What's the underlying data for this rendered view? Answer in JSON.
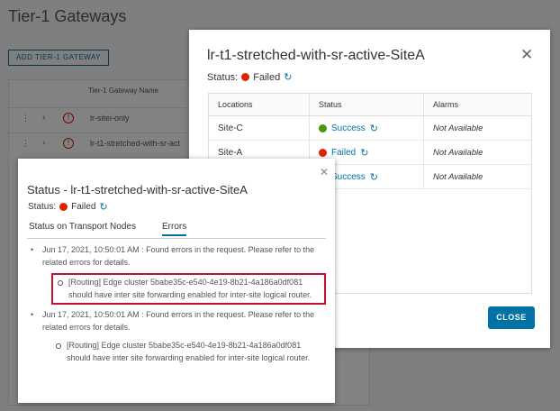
{
  "background": {
    "title": "Tier-1 Gateways",
    "add_button": "ADD TIER-1 GATEWAY",
    "column_header": "Tier-1 Gateway Name",
    "rows": [
      {
        "name": "lr-sitei-only"
      },
      {
        "name": "lr-t1-stretched-with-sr-act"
      }
    ]
  },
  "modal": {
    "title": "lr-t1-stretched-with-sr-active-SiteA",
    "status_label": "Status:",
    "status_value": "Failed",
    "table": {
      "headers": [
        "Locations",
        "Status",
        "Alarms"
      ],
      "rows": [
        {
          "location": "Site-C",
          "status": "Success",
          "alarms": "Not Available"
        },
        {
          "location": "Site-A",
          "status": "Failed",
          "alarms": "Not Available"
        },
        {
          "location": "",
          "status": "Success",
          "alarms": "Not Available"
        }
      ]
    },
    "close_button": "CLOSE"
  },
  "popover": {
    "title": "Status - lr-t1-stretched-with-sr-active-SiteA",
    "status_label": "Status:",
    "status_value": "Failed",
    "tabs": [
      "Status on Transport Nodes",
      "Errors"
    ],
    "active_tab": "Errors",
    "errors": [
      {
        "text": "Jun 17, 2021, 10:50:01 AM : Found errors in the request. Please refer to the related errors for details.",
        "detail": "[Routing] Edge cluster 5babe35c-e540-4e19-8b21-4a186a0df081 should have inter site forwarding enabled for inter-site logical router."
      },
      {
        "text": "Jun 17, 2021, 10:50:01 AM : Found errors in the request. Please refer to the related errors for details.",
        "detail": "[Routing] Edge cluster 5babe35c-e540-4e19-8b21-4a186a0df081 should have inter site forwarding enabled for inter-site logical router."
      }
    ]
  },
  "colors": {
    "accent": "#0072a3",
    "failed": "#e02200",
    "success": "#48960c",
    "highlight": "#c8102e"
  },
  "icons": [
    "close-icon",
    "refresh-icon",
    "error-icon",
    "chevron-right-icon",
    "more-vertical-icon"
  ]
}
